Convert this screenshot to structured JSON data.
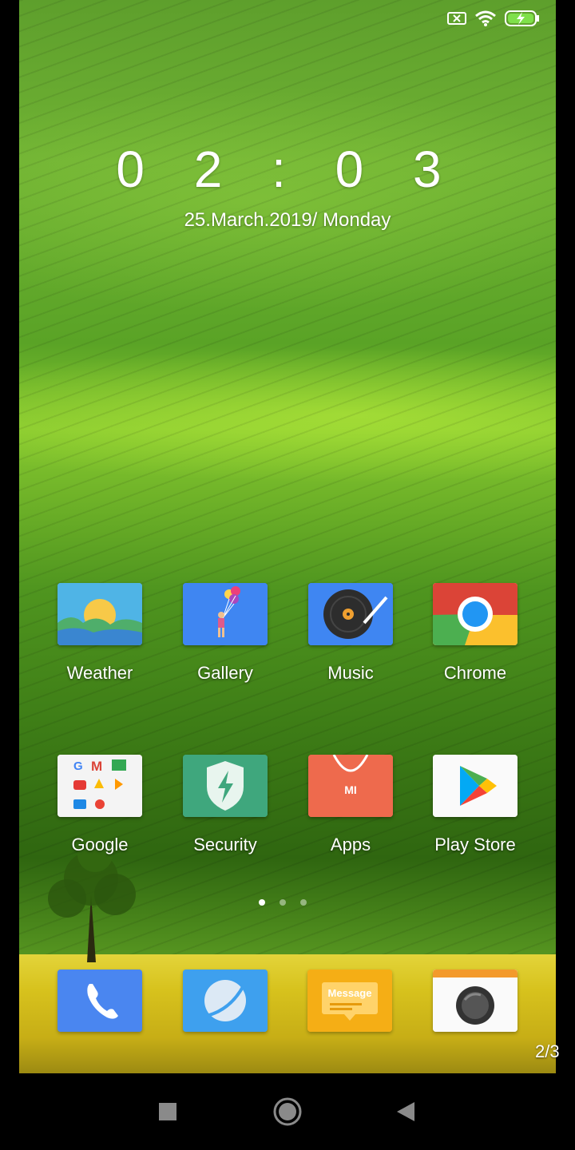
{
  "status_bar": {
    "icons": [
      "sim-off-icon",
      "wifi-icon",
      "battery-charging-icon"
    ]
  },
  "lock_clock": {
    "time": "0 2 : 0 3",
    "date": "25.March.2019/ Monday"
  },
  "home_grid": {
    "row1": [
      {
        "label": "Weather",
        "icon": "weather-icon"
      },
      {
        "label": "Gallery",
        "icon": "gallery-icon"
      },
      {
        "label": "Music",
        "icon": "music-icon"
      },
      {
        "label": "Chrome",
        "icon": "chrome-icon"
      }
    ],
    "row2": [
      {
        "label": "Google",
        "icon": "google-folder-icon"
      },
      {
        "label": "Security",
        "icon": "security-icon"
      },
      {
        "label": "Apps",
        "icon": "mi-apps-icon"
      },
      {
        "label": "Play Store",
        "icon": "play-store-icon"
      }
    ]
  },
  "page_indicator": {
    "pages": 3,
    "current": 1
  },
  "dock": {
    "items": [
      {
        "icon": "phone-icon"
      },
      {
        "icon": "browser-icon"
      },
      {
        "icon": "message-icon",
        "text": "Message"
      },
      {
        "icon": "camera-icon"
      }
    ]
  },
  "pager_label": "2/3",
  "nav_bar": {
    "icons": [
      "recent-apps-icon",
      "home-icon",
      "back-icon"
    ]
  },
  "colors": {
    "dock_phone": "#4a86f0",
    "message_yellow": "#f5ae15",
    "security_green": "#3fa77d",
    "apps_orange": "#ee6a4d"
  }
}
